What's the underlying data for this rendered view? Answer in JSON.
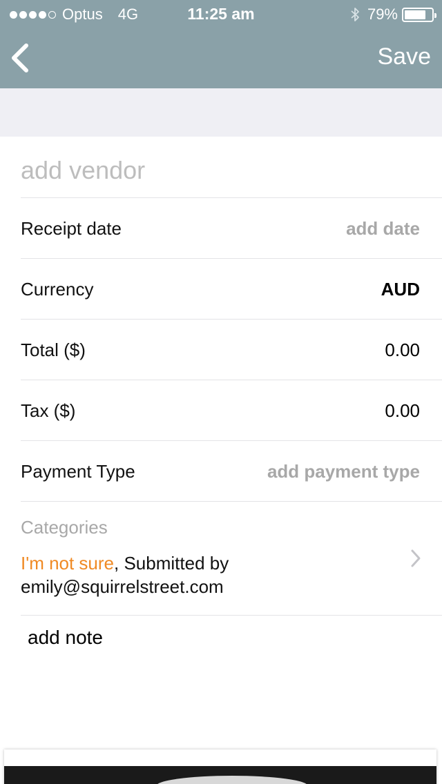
{
  "status_bar": {
    "carrier": "Optus",
    "network": "4G",
    "time": "11:25 am",
    "battery_percent": "79%",
    "battery_level": 0.79,
    "signal_bars_filled": 4,
    "signal_bars_total": 5
  },
  "nav": {
    "back_icon": "chevron-left-icon",
    "save_label": "Save",
    "bar_color": "#8aa1a8"
  },
  "form": {
    "vendor_placeholder": "add vendor",
    "receipt_date": {
      "label": "Receipt date",
      "value": "add date"
    },
    "currency": {
      "label": "Currency",
      "value": "AUD"
    },
    "total": {
      "label": "Total ($)",
      "value": "0.00"
    },
    "tax": {
      "label": "Tax ($)",
      "value": "0.00"
    },
    "payment_type": {
      "label": "Payment Type",
      "value": "add payment type"
    },
    "categories": {
      "heading": "Categories",
      "highlight": "I'm not sure",
      "rest": ", Submitted by emily@squirrelstreet.com",
      "highlight_color": "#f08a24"
    },
    "note_placeholder": "add note"
  }
}
